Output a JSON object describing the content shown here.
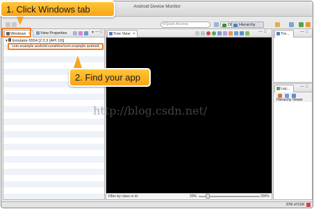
{
  "window": {
    "title": "Android Device Monitor"
  },
  "toolbar": {
    "quick_access_placeholder": "Quick Access",
    "perspective_ddms": "DDMS",
    "perspective_hierarchy": "Hierarchy View"
  },
  "left_pane": {
    "tabs": [
      {
        "label": "Windows",
        "close": "⨯"
      },
      {
        "label": "View Properties"
      }
    ],
    "device_row": "Emulator-5554 [2.3.3 (API 10)]",
    "app_row": "com.example.android.sunshine/com.example.android."
  },
  "tree_view": {
    "tab_label": "Tree View",
    "close": "⨯"
  },
  "right_top": {
    "tab_label": "Tre..."
  },
  "right_bottom": {
    "tab_label": "Lay...",
    "sub_label": "Hierarchy Viewer"
  },
  "filter_bar": {
    "placeholder": "Filter by class or id:",
    "zoom_left": "20%",
    "zoom_right": "200%"
  },
  "status_bar": {
    "memory": "37M of 51M"
  },
  "callouts": {
    "step1": "1. Click Windows tab",
    "step2": "2. Find your app"
  },
  "watermark": "http://blog.csdn.net/",
  "colors": {
    "callout": "#f9a51a",
    "highlight_border": "#ef7d22",
    "canvas": "#000000"
  }
}
